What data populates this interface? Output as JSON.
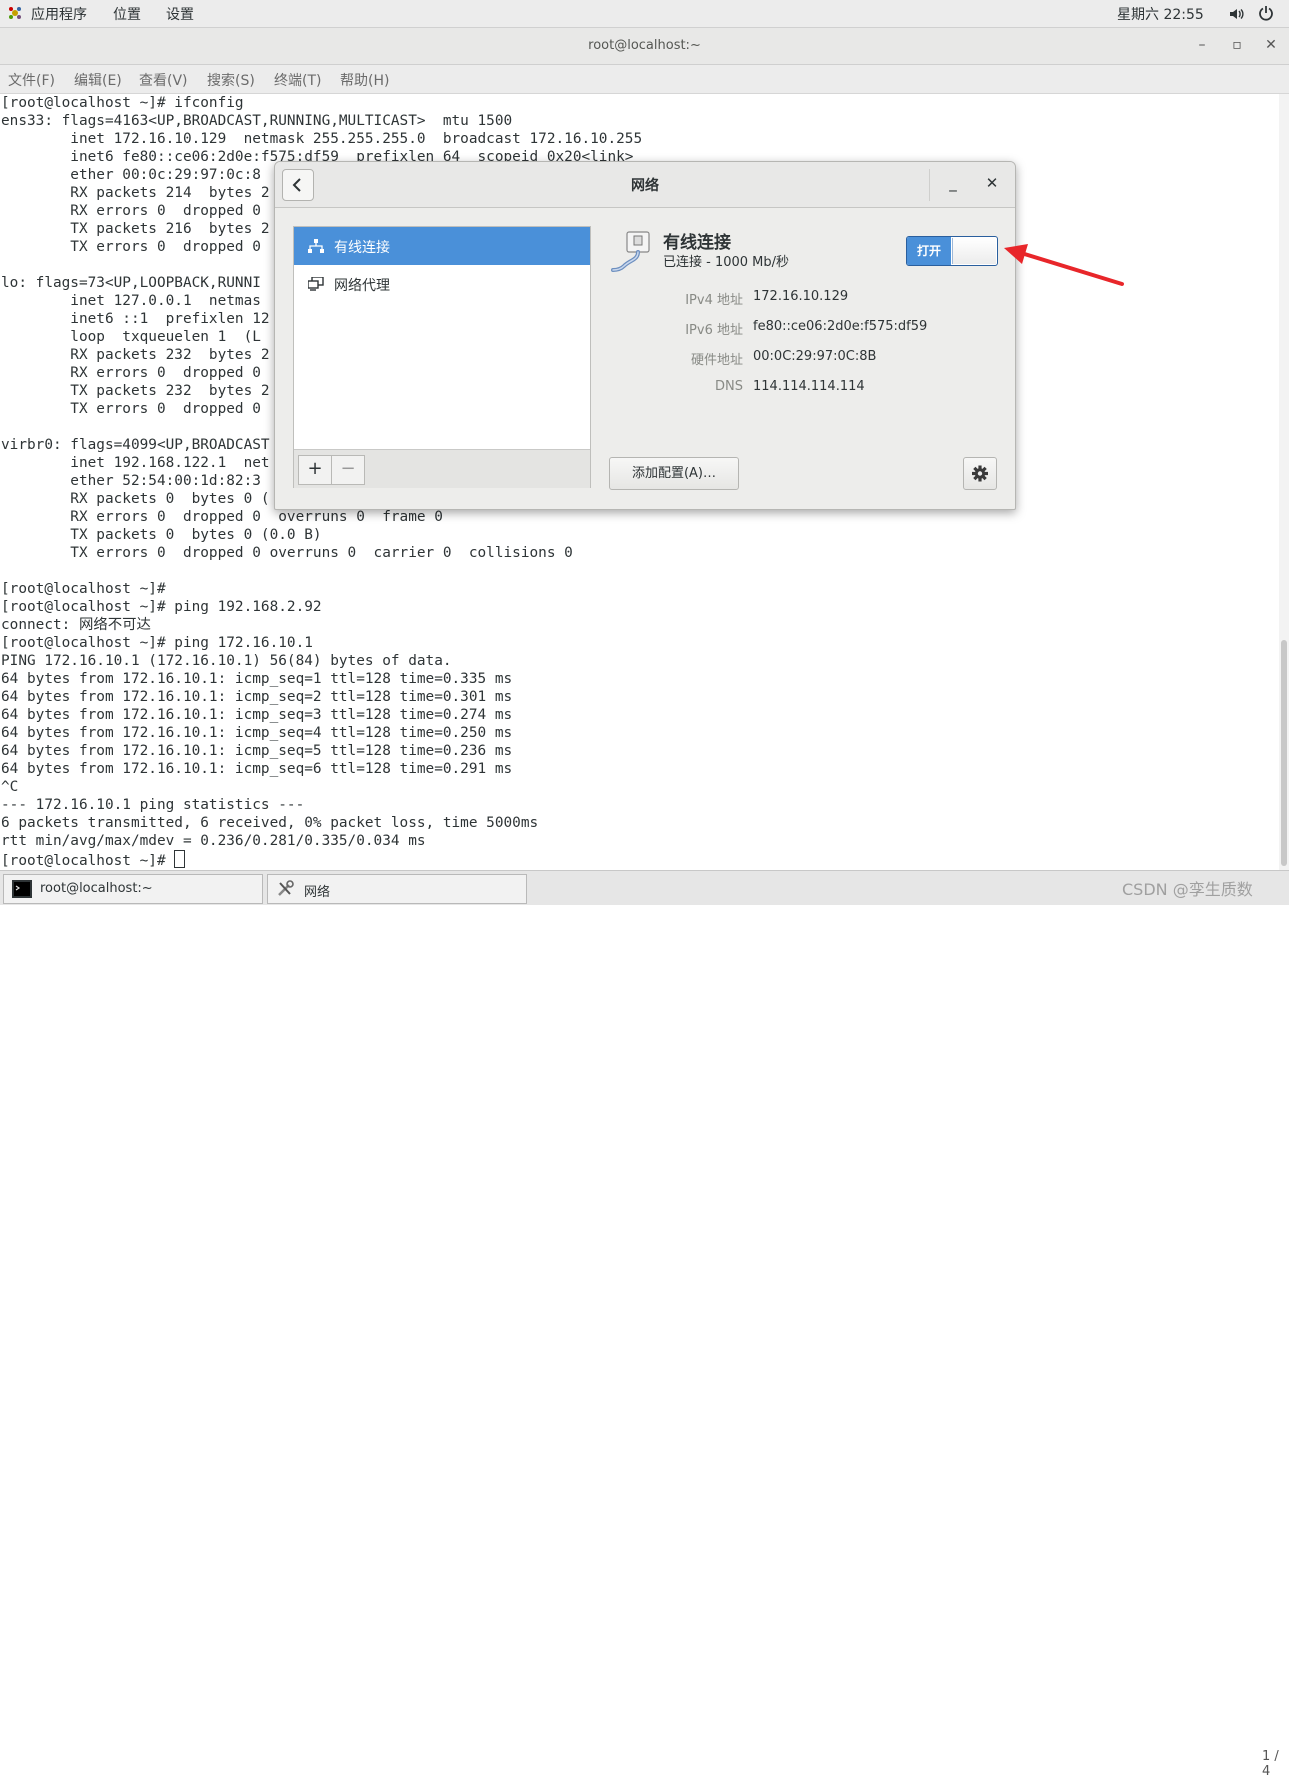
{
  "topbar": {
    "apps": "应用程序",
    "places": "位置",
    "settings": "设置",
    "clock": "星期六 22:55"
  },
  "terminal": {
    "title": "root@localhost:~",
    "menu": [
      "文件(F)",
      "编辑(E)",
      "查看(V)",
      "搜索(S)",
      "终端(T)",
      "帮助(H)"
    ],
    "lines": [
      "[root@localhost ~]# ifconfig",
      "ens33: flags=4163<UP,BROADCAST,RUNNING,MULTICAST>  mtu 1500",
      "        inet 172.16.10.129  netmask 255.255.255.0  broadcast 172.16.10.255",
      "        inet6 fe80::ce06:2d0e:f575:df59  prefixlen 64  scopeid 0x20<link>",
      "        ether 00:0c:29:97:0c:8",
      "        RX packets 214  bytes 2",
      "        RX errors 0  dropped 0",
      "        TX packets 216  bytes 2",
      "        TX errors 0  dropped 0",
      "",
      "lo: flags=73<UP,LOOPBACK,RUNNI",
      "        inet 127.0.0.1  netmas",
      "        inet6 ::1  prefixlen 12",
      "        loop  txqueuelen 1  (L",
      "        RX packets 232  bytes 2",
      "        RX errors 0  dropped 0",
      "        TX packets 232  bytes 2",
      "        TX errors 0  dropped 0",
      "",
      "virbr0: flags=4099<UP,BROADCAST",
      "        inet 192.168.122.1  net",
      "        ether 52:54:00:1d:82:3",
      "        RX packets 0  bytes 0 (",
      "        RX errors 0  dropped 0  overruns 0  frame 0",
      "        TX packets 0  bytes 0 (0.0 B)",
      "        TX errors 0  dropped 0 overruns 0  carrier 0  collisions 0",
      "",
      "[root@localhost ~]#",
      "[root@localhost ~]# ping 192.168.2.92",
      "connect: 网络不可达",
      "[root@localhost ~]# ping 172.16.10.1",
      "PING 172.16.10.1 (172.16.10.1) 56(84) bytes of data.",
      "64 bytes from 172.16.10.1: icmp_seq=1 ttl=128 time=0.335 ms",
      "64 bytes from 172.16.10.1: icmp_seq=2 ttl=128 time=0.301 ms",
      "64 bytes from 172.16.10.1: icmp_seq=3 ttl=128 time=0.274 ms",
      "64 bytes from 172.16.10.1: icmp_seq=4 ttl=128 time=0.250 ms",
      "64 bytes from 172.16.10.1: icmp_seq=5 ttl=128 time=0.236 ms",
      "64 bytes from 172.16.10.1: icmp_seq=6 ttl=128 time=0.291 ms",
      "^C",
      "--- 172.16.10.1 ping statistics ---",
      "6 packets transmitted, 6 received, 0% packet loss, time 5000ms",
      "rtt min/avg/max/mdev = 0.236/0.281/0.335/0.034 ms"
    ],
    "prompt": "[root@localhost ~]# "
  },
  "dialog": {
    "title": "网络",
    "sidebar": [
      {
        "label": "有线连接",
        "icon": "wired-network-icon",
        "active": true
      },
      {
        "label": "网络代理",
        "icon": "proxy-icon",
        "active": false
      }
    ],
    "add_label": "+",
    "remove_label": "−",
    "connection_name": "有线连接",
    "connection_status": "已连接 - 1000 Mb/秒",
    "toggle_label": "打开",
    "details": [
      {
        "label": "IPv4 地址",
        "value": "172.16.10.129"
      },
      {
        "label": "IPv6 地址",
        "value": "fe80::ce06:2d0e:f575:df59"
      },
      {
        "label": "硬件地址",
        "value": "00:0C:29:97:0C:8B"
      },
      {
        "label": "DNS",
        "value": "114.114.114.114"
      }
    ],
    "add_config_label": "添加配置(A)…"
  },
  "taskbar": {
    "tasks": [
      {
        "label": "root@localhost:~"
      },
      {
        "label": "网络"
      }
    ],
    "page": "1 / 4"
  },
  "watermark": "CSDN @孪生质数",
  "colors": {
    "accent": "#4a90d9",
    "arrow": "#e8262a"
  }
}
